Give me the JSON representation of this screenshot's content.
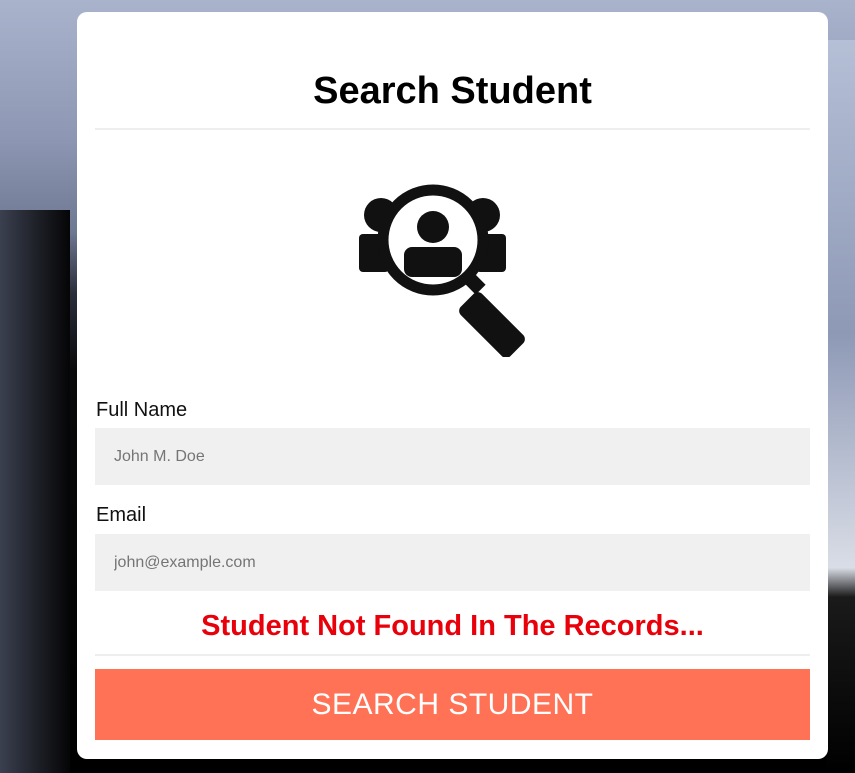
{
  "form": {
    "title": "Search Student",
    "hero_icon": "search-people-icon",
    "fields": {
      "full_name": {
        "label": "Full Name",
        "placeholder": "John M. Doe",
        "value": ""
      },
      "email": {
        "label": "Email",
        "placeholder": "john@example.com",
        "value": ""
      }
    },
    "error_message": "Student Not Found In The Records...",
    "submit_label": "SEARCH STUDENT"
  },
  "colors": {
    "card_background": "#ffffff",
    "field_background": "#f0f0f0",
    "error_text": "#e8000a",
    "submit_background": "#ff7256",
    "submit_text": "#ffffff"
  }
}
